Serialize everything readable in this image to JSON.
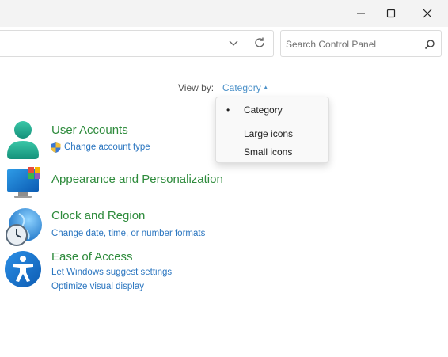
{
  "window_controls": {
    "minimize_glyph": "—",
    "maximize_glyph": "☐",
    "close_glyph": "✕"
  },
  "search": {
    "placeholder": "Search Control Panel",
    "value": ""
  },
  "view_by": {
    "label": "View by:",
    "value": "Category",
    "caret": "▲",
    "options": [
      {
        "label": "Category",
        "selected": true,
        "bullet": "•"
      },
      {
        "label": "Large icons",
        "selected": false
      },
      {
        "label": "Small icons",
        "selected": false
      }
    ]
  },
  "categories": [
    {
      "title": "User Accounts",
      "links": [
        "Change account type"
      ],
      "icon": "user-accounts-icon"
    },
    {
      "title": "Appearance and Personalization",
      "links": [],
      "icon": "appearance-personalization-icon"
    },
    {
      "title": "Clock and Region",
      "links": [
        "Change date, time, or number formats"
      ],
      "icon": "clock-region-icon"
    },
    {
      "title": "Ease of Access",
      "links": [
        "Let Windows suggest settings",
        "Optimize visual display"
      ],
      "icon": "ease-of-access-icon"
    }
  ],
  "colors": {
    "title_green": "#2e8b3c",
    "link_blue": "#2b76c0",
    "accent_blue": "#4a90c8"
  }
}
